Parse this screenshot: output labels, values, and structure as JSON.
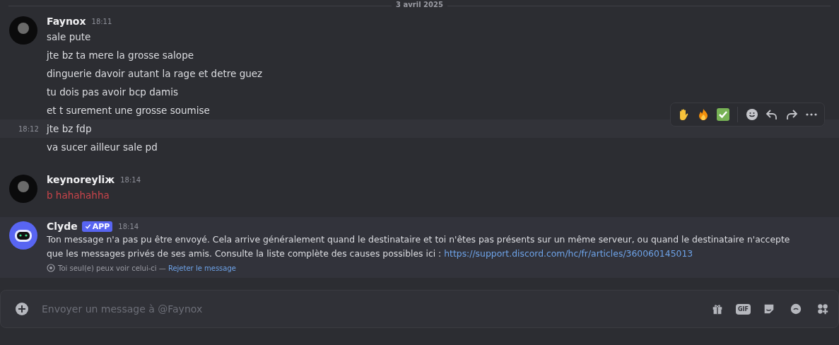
{
  "date_divider": "3 avril 2025",
  "groups": [
    {
      "author": "Faynox",
      "time": "18:11",
      "kind": "user",
      "ephemeral": false,
      "messages": [
        {
          "text": "sale pute",
          "hovered": false
        },
        {
          "text": "jte bz ta mere la grosse salope",
          "hovered": false
        },
        {
          "text": "dinguerie davoir autant la rage et detre guez",
          "hovered": false
        },
        {
          "text": "tu dois pas avoir bcp damis",
          "hovered": false
        },
        {
          "text": "et t surement une grosse soumise",
          "hovered": false
        },
        {
          "text": "jte bz fdp",
          "time": "18:12",
          "hovered": true
        },
        {
          "text": "va sucer ailleur sale pd",
          "hovered": false
        }
      ]
    },
    {
      "author": "keynoreyliж",
      "time": "18:14",
      "kind": "user",
      "ephemeral": false,
      "messages": [
        {
          "text": "b hahahahha",
          "hovered": false,
          "color": "#c9444a"
        }
      ]
    },
    {
      "author": "Clyde",
      "badge": "APP",
      "time": "18:14",
      "kind": "bot",
      "ephemeral": true,
      "messages": [
        {
          "text": "Ton message n'a pas pu être envoyé. Cela arrive généralement quand le destinataire et toi n'êtes pas présents sur un même serveur, ou quand le destinataire n'accepte que les messages privés de ses amis. Consulte la liste complète des causes possibles ici : ",
          "link": "https://support.discord.com/hc/fr/articles/360060145013",
          "hovered": false
        }
      ],
      "notice": "Toi seul(e) peux voir celui-ci — ",
      "notice_link": "Rejeter le message"
    }
  ],
  "composer": {
    "placeholder": "Envoyer un message à @Faynox",
    "gif_label": "GIF"
  }
}
